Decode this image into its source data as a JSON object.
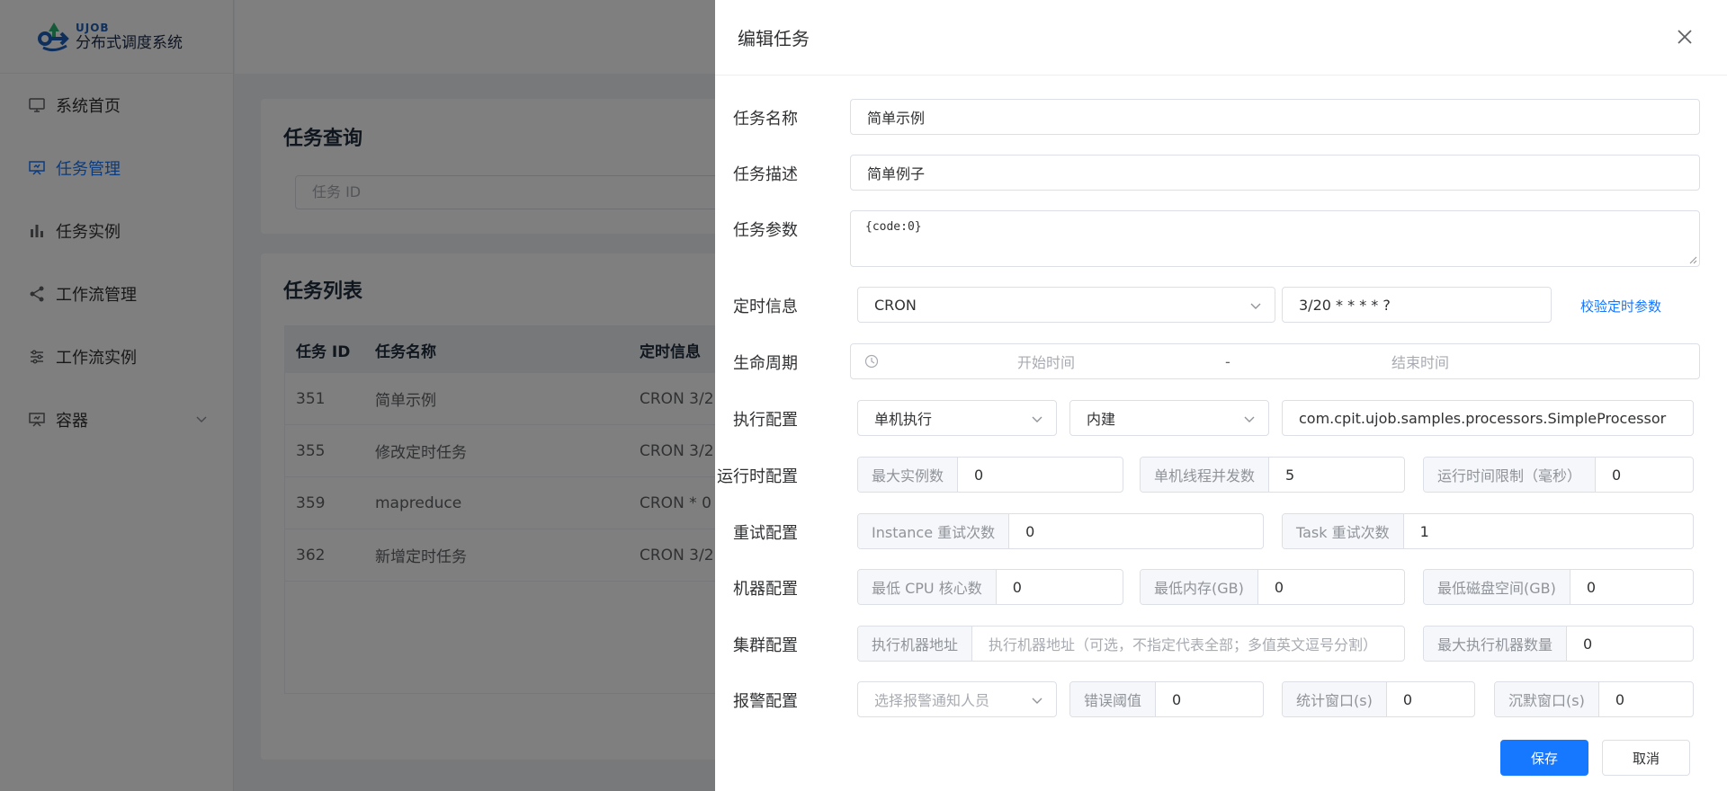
{
  "app": {
    "logo_en": "UJOB",
    "logo_cn": "分布式调度系统",
    "menu": [
      {
        "label": "系统首页",
        "icon": "monitor-icon"
      },
      {
        "label": "任务管理",
        "icon": "presentation-icon",
        "active": true
      },
      {
        "label": "任务实例",
        "icon": "bar-chart-icon"
      },
      {
        "label": "工作流管理",
        "icon": "share-icon"
      },
      {
        "label": "工作流实例",
        "icon": "sliders-icon"
      },
      {
        "label": "容器",
        "icon": "presentation-icon"
      }
    ]
  },
  "query_card": {
    "title": "任务查询",
    "task_id_placeholder": "任务 ID"
  },
  "list_card": {
    "title": "任务列表",
    "columns": [
      "任务 ID",
      "任务名称",
      "定时信息"
    ],
    "rows": [
      {
        "id": "351",
        "name": "简单示例",
        "schedule": "CRON 3/2"
      },
      {
        "id": "355",
        "name": "修改定时任务",
        "schedule": "CRON 3/2"
      },
      {
        "id": "359",
        "name": "mapreduce",
        "schedule": "CRON * 0"
      },
      {
        "id": "362",
        "name": "新增定时任务",
        "schedule": "CRON 3/2"
      }
    ]
  },
  "drawer": {
    "title": "编辑任务",
    "labels": {
      "name": "任务名称",
      "desc": "任务描述",
      "params": "任务参数",
      "schedule": "定时信息",
      "lifecycle": "生命周期",
      "exec": "执行配置",
      "runtime": "运行时配置",
      "retry": "重试配置",
      "machine": "机器配置",
      "cluster": "集群配置",
      "alarm": "报警配置"
    },
    "name_value": "简单示例",
    "desc_value": "简单例子",
    "params_value": "{code:0}",
    "schedule_type": "CRON",
    "cron_expression": "3/20 * * * * ?",
    "validate_link": "校验定时参数",
    "start_placeholder": "开始时间",
    "range_separator": "-",
    "end_placeholder": "结束时间",
    "exec_mode": "单机执行",
    "processor_type": "内建",
    "processor_class": "com.cpit.ujob.samples.processors.SimpleProcessor",
    "runtime": {
      "max_instances_label": "最大实例数",
      "max_instances": "0",
      "threads_label": "单机线程并发数",
      "threads": "5",
      "time_limit_label": "运行时间限制（毫秒）",
      "time_limit": "0"
    },
    "retry": {
      "instance_label": "Instance 重试次数",
      "instance": "0",
      "task_label": "Task 重试次数",
      "task": "1"
    },
    "machine": {
      "cpu_label": "最低 CPU 核心数",
      "cpu": "0",
      "mem_label": "最低内存(GB)",
      "mem": "0",
      "disk_label": "最低磁盘空间(GB)",
      "disk": "0"
    },
    "cluster": {
      "address_label": "执行机器地址",
      "address_placeholder": "执行机器地址（可选，不指定代表全部；多值英文逗号分割）",
      "max_machines_label": "最大执行机器数量",
      "max_machines": "0"
    },
    "alarm": {
      "receivers_placeholder": "选择报警通知人员",
      "error_threshold_label": "错误阈值",
      "error_threshold": "0",
      "window_label": "统计窗口(s)",
      "window": "0",
      "silence_label": "沉默窗口(s)",
      "silence": "0"
    },
    "save_label": "保存",
    "cancel_label": "取消"
  }
}
